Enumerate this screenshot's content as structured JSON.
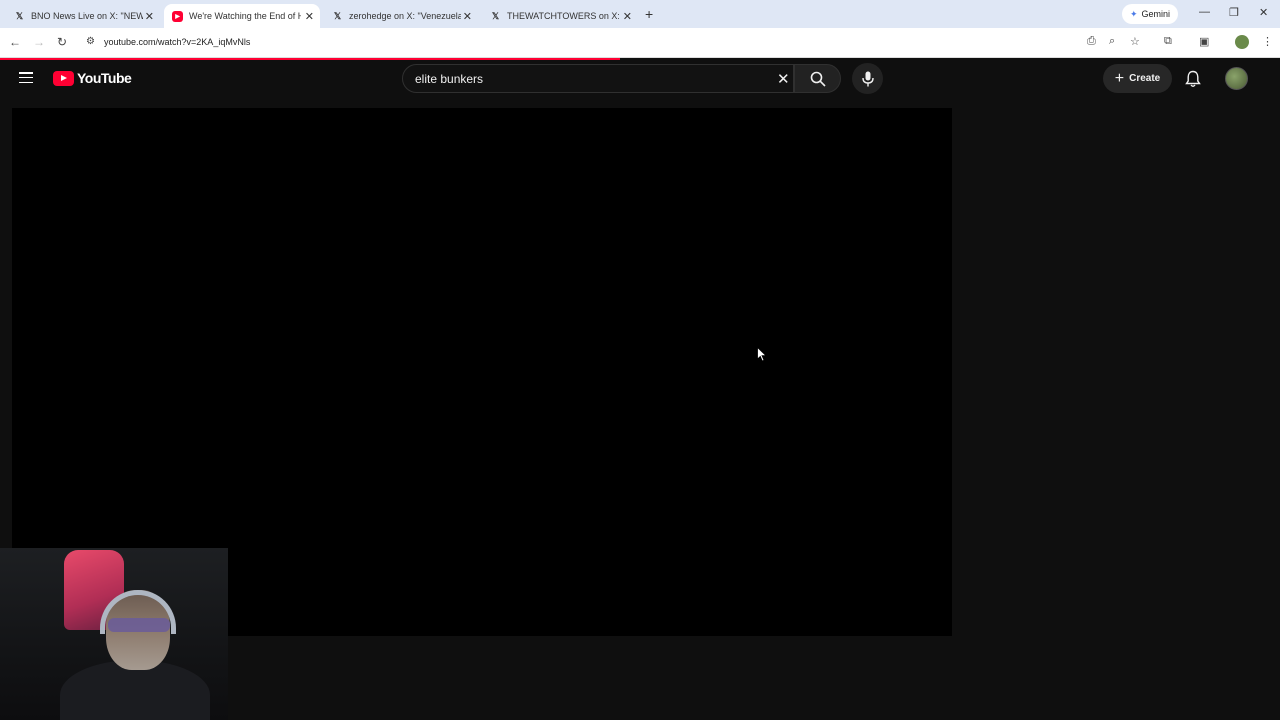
{
  "browser": {
    "tabs": [
      {
        "title": "BNO News Live on X: \"NEW: Tru",
        "favicon": "x-logo-icon",
        "active": false
      },
      {
        "title": "We're Watching the End of Hur",
        "favicon": "youtube-icon",
        "active": true
      },
      {
        "title": "zerohedge on X: \"Venezuela, Sl",
        "favicon": "x-logo-icon",
        "active": false
      },
      {
        "title": "THEWATCHTOWERS on X: \"IT K",
        "favicon": "x-logo-icon",
        "active": false
      }
    ],
    "gemini_label": "Gemini",
    "url": "youtube.com/watch?v=2KA_iqMvNls"
  },
  "youtube": {
    "logo_text": "YouTube",
    "search_value": "elite bunkers",
    "create_label": "Create"
  },
  "colors": {
    "accent": "#ff0033",
    "background": "#0f0f0f"
  }
}
